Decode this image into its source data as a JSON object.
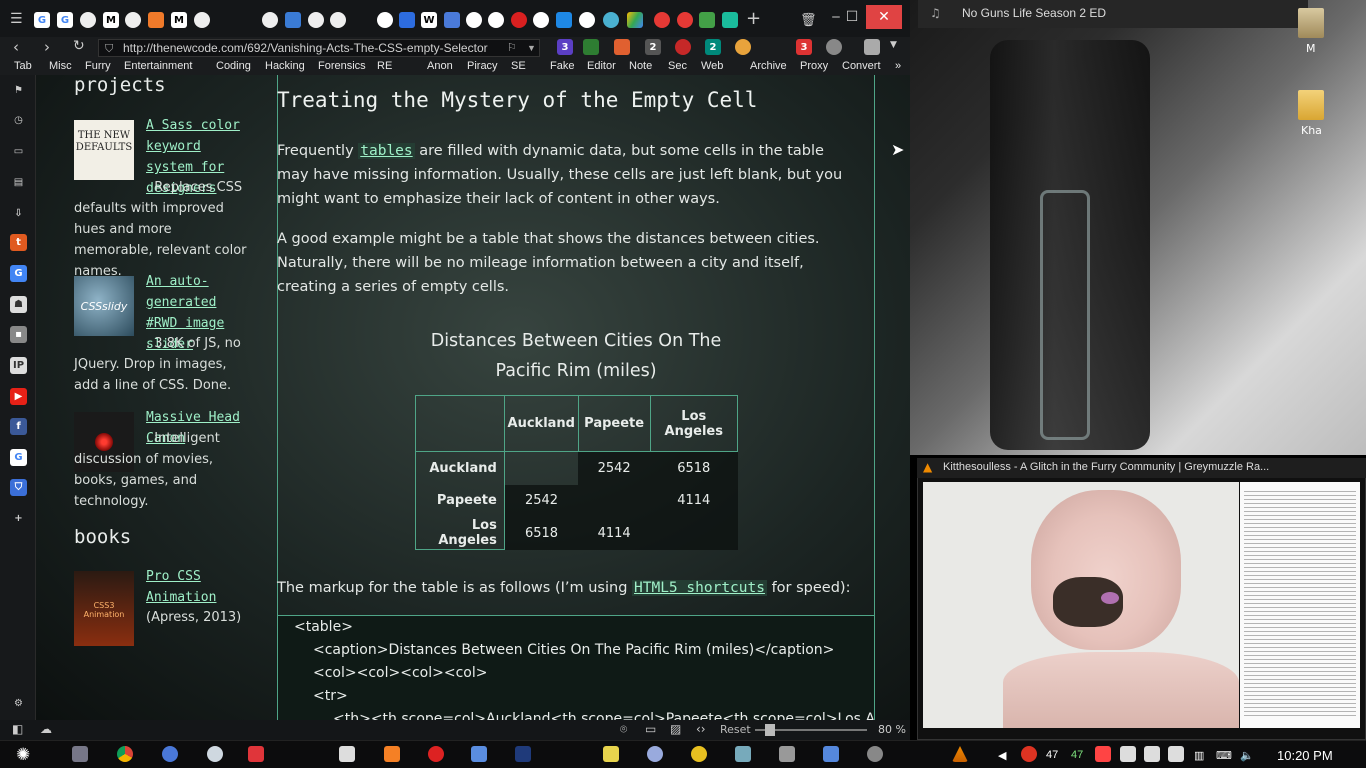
{
  "browser": {
    "url": "http://thenewcode.com/692/Vanishing-Acts-The-CSS-empty-Selector",
    "zoom": "80 %",
    "zoom_reset": "Reset",
    "bookmarks": [
      "Tab",
      "Misc",
      "Furry",
      "Entertainment",
      "Coding",
      "Hacking",
      "Forensics",
      "RE",
      "Anon",
      "Piracy",
      "SE",
      "Fake",
      "Editor",
      "Note",
      "Sec",
      "Web",
      "Archive",
      "Proxy",
      "Convert"
    ],
    "tab_favicons": [
      "G",
      "G",
      "M",
      "M",
      "W",
      "G"
    ],
    "ext_badges": [
      "3",
      "2",
      "2",
      "3"
    ]
  },
  "left": {
    "projects_heading": "projects",
    "project1_link": "A Sass color keyword system for designers",
    "project1_text": ". Replaces CSS defaults with improved hues and more memorable, relevant color names.",
    "project1_thumb": "THE NEW DEFAULTS",
    "project2_link": "An auto-generated #RWD image slider",
    "project2_text": ". 3.8K of JS, no JQuery. Drop in images, add a line of CSS. Done.",
    "project2_thumb": "CSSslidy",
    "project3_link": "Massive Head Canon",
    "project3_text": ". Intelligent discussion of movies, books, games, and technology.",
    "books_heading": "books",
    "book1_link": "Pro CSS Animation",
    "book1_text": "(Apress, 2013)",
    "book1_thumb": "CSS3 Animation"
  },
  "article": {
    "heading": "Treating the Mystery of the Empty Cell",
    "p1_a": "Frequently ",
    "p1_link": "tables",
    "p1_b": " are filled with dynamic data, but some cells in the table may have missing information. Usually, these cells are just left blank, but you might want to emphasize their lack of content in other ways.",
    "p2": "A good example might be a table that shows the distances between cities. Naturally, there will be no mileage information between a city and itself, creating a series of empty cells.",
    "p3_a": "The markup for the table is as follows (I’m using ",
    "p3_link": "HTML5 shortcuts",
    "p3_b": " for speed):",
    "caption": "Distances Between Cities On The Pacific Rim (miles)",
    "columns": [
      "",
      "Auckland",
      "Papeete",
      "Los Angeles"
    ],
    "rows": [
      [
        "Auckland",
        "",
        "2542",
        "6518"
      ],
      [
        "Papeete",
        "2542",
        "",
        "4114"
      ],
      [
        "Los Angeles",
        "6518",
        "4114",
        ""
      ]
    ],
    "code": [
      "<table>",
      "<caption>Distances Between Cities On The Pacific Rim (miles)</caption>",
      "<col><col><col><col>",
      "<tr>",
      "<th><th scope=col>Auckland<th scope=col>Papeete<th scope=col>Los Angeles"
    ]
  },
  "desktop": {
    "now_playing": "No Guns Life Season 2 ED",
    "icon1_label": "M",
    "icon2_label": "Kha"
  },
  "vlc": {
    "title": "Kitthesoulless - A Glitch in the Furry Community | Greymuzzle Ra..."
  },
  "taskbar": {
    "tray_num1": "47",
    "tray_num2": "47",
    "clock": "10:20 PM"
  }
}
